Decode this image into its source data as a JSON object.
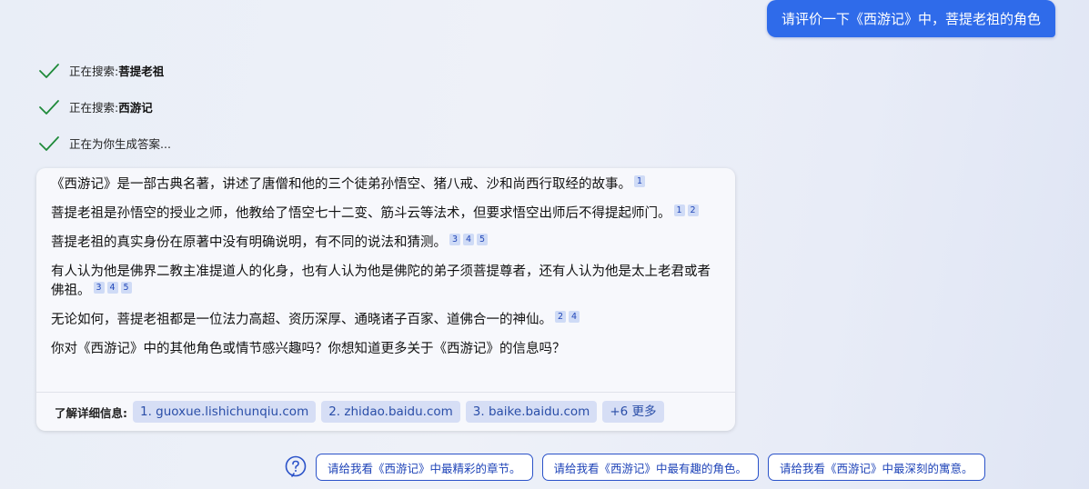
{
  "user_message": "请评价一下《西游记》中，菩提老祖的角色",
  "status": [
    {
      "prefix": "正在搜索: ",
      "term": "菩提老祖"
    },
    {
      "prefix": "正在搜索: ",
      "term": "西游记"
    },
    {
      "prefix": "正在为你生成答案...",
      "term": ""
    }
  ],
  "answer": {
    "paragraphs": [
      {
        "text": "《西游记》是一部古典名著，讲述了唐僧和他的三个徒弟孙悟空、猪八戒、沙和尚西行取经的故事。",
        "cites": [
          "1"
        ]
      },
      {
        "text": "菩提老祖是孙悟空的授业之师，他教给了悟空七十二变、筋斗云等法术，但要求悟空出师后不得提起师门。",
        "cites": [
          "1",
          "2"
        ]
      },
      {
        "text": "菩提老祖的真实身份在原著中没有明确说明，有不同的说法和猜测。",
        "cites": [
          "3",
          "4",
          "5"
        ]
      },
      {
        "text": "有人认为他是佛界二教主准提道人的化身，也有人认为他是佛陀的弟子须菩提尊者，还有人认为他是太上老君或者佛祖。",
        "cites": [
          "3",
          "4",
          "5"
        ]
      },
      {
        "text": "无论如何，菩提老祖都是一位法力高超、资历深厚、通晓诸子百家、道佛合一的神仙。",
        "cites": [
          "2",
          "4"
        ]
      },
      {
        "text": "你对《西游记》中的其他角色或情节感兴趣吗？你想知道更多关于《西游记》的信息吗？",
        "cites": []
      }
    ]
  },
  "learn_more": {
    "label": "了解详细信息:",
    "sources": [
      "1. guoxue.lishichunqiu.com",
      "2. zhidao.baidu.com",
      "3. baike.baidu.com"
    ],
    "more": "+6 更多"
  },
  "suggestions": [
    "请给我看《西游记》中最精彩的章节。",
    "请给我看《西游记》中最有趣的角色。",
    "请给我看《西游记》中最深刻的寓意。"
  ],
  "colors": {
    "accent": "#2f6bea",
    "check": "#1f8a3a",
    "chip": "#d6def5"
  }
}
